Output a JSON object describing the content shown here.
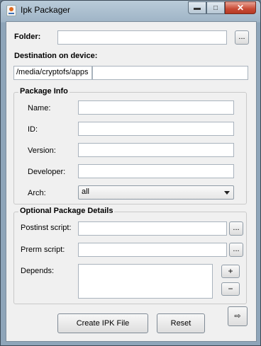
{
  "window": {
    "title": "Ipk Packager"
  },
  "folder": {
    "label": "Folder:",
    "value": "",
    "browse": "..."
  },
  "destination": {
    "label": "Destination on device:",
    "path": "/media/cryptofs/apps",
    "value": ""
  },
  "package_info": {
    "title": "Package Info",
    "name_label": "Name:",
    "id_label": "ID:",
    "version_label": "Version:",
    "developer_label": "Developer:",
    "arch_label": "Arch:",
    "arch_value": "all"
  },
  "optional": {
    "title": "Optional Package Details",
    "postinst_label": "Postinst script:",
    "prerm_label": "Prerm script:",
    "depends_label": "Depends:",
    "browse": "...",
    "add": "+",
    "remove": "−"
  },
  "actions": {
    "create": "Create IPK File",
    "reset": "Reset",
    "arrow": "⇨"
  },
  "colors": {
    "titlebar": "#9fb4c6",
    "close": "#c84a35",
    "client_bg": "#f0f0f0"
  }
}
